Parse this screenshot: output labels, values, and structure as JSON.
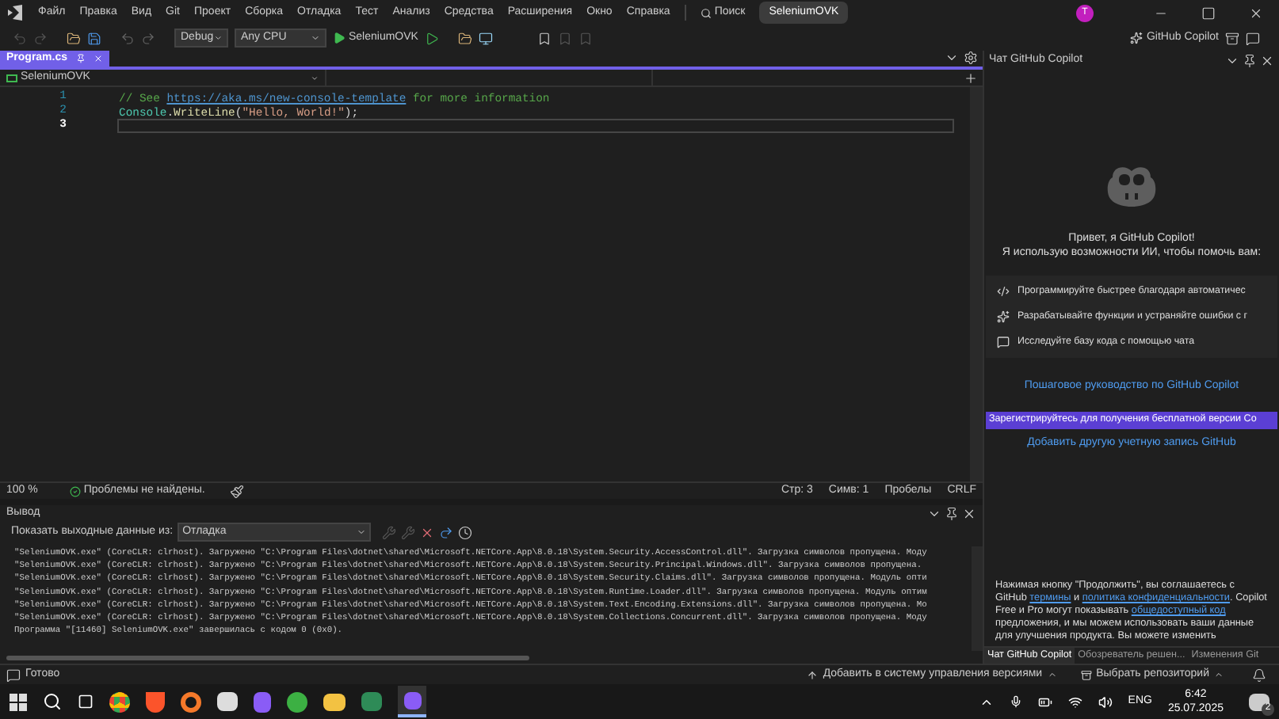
{
  "menu_bar": {
    "items": [
      "Файл",
      "Правка",
      "Вид",
      "Git",
      "Проект",
      "Сборка",
      "Отладка",
      "Тест",
      "Анализ",
      "Средства",
      "Расширения",
      "Окно",
      "Справка"
    ],
    "search": "Поиск",
    "solution": "SeleniumOVK",
    "avatar": "T"
  },
  "toolbar": {
    "configuration": "Debug",
    "platform": "Any CPU",
    "run_target": "SeleniumOVK",
    "copilot": "GitHub Copilot"
  },
  "editor": {
    "tabs": [
      {
        "label": "Program.cs",
        "selected": true
      }
    ],
    "nav": {
      "project": "SeleniumOVK"
    },
    "lines": [
      {
        "number": "1",
        "current": false,
        "tokens": [
          {
            "kind": "comment",
            "text": "// See "
          },
          {
            "kind": "link",
            "text": "https://aka.ms/new-console-template"
          },
          {
            "kind": "comment",
            "text": " for more information"
          }
        ]
      },
      {
        "number": "2",
        "current": false,
        "tokens": [
          {
            "kind": "type",
            "text": "Console"
          },
          {
            "kind": "plain",
            "text": "."
          },
          {
            "kind": "method",
            "text": "WriteLine"
          },
          {
            "kind": "plain",
            "text": "("
          },
          {
            "kind": "string",
            "text": "\"Hello, World!\""
          },
          {
            "kind": "plain",
            "text": ");"
          }
        ]
      },
      {
        "number": "3",
        "current": true
      }
    ]
  },
  "editor_status": {
    "zoom": "100 %",
    "issues": "Проблемы не найдены.",
    "line": "Стр: 3",
    "column": "Симв: 1",
    "whitespace": "Пробелы",
    "line_ending": "CRLF"
  },
  "output": {
    "title": "Вывод",
    "source_label": "Показать выходные данные из:",
    "source": "Отладка",
    "lines": [
      "\"SeleniumOVK.exe\" (CoreCLR: clrhost). Загружено \"C:\\Program Files\\dotnet\\shared\\Microsoft.NETCore.App\\8.0.18\\System.Security.AccessControl.dll\". Загрузка символов пропущена. Моду",
      "\"SeleniumOVK.exe\" (CoreCLR: clrhost). Загружено \"C:\\Program Files\\dotnet\\shared\\Microsoft.NETCore.App\\8.0.18\\System.Security.Principal.Windows.dll\". Загрузка символов пропущена.",
      "\"SeleniumOVK.exe\" (CoreCLR: clrhost). Загружено \"C:\\Program Files\\dotnet\\shared\\Microsoft.NETCore.App\\8.0.18\\System.Security.Claims.dll\". Загрузка символов пропущена. Модуль опти",
      "\"SeleniumOVK.exe\" (CoreCLR: clrhost). Загружено \"C:\\Program Files\\dotnet\\shared\\Microsoft.NETCore.App\\8.0.18\\System.Runtime.Loader.dll\". Загрузка символов пропущена. Модуль оптим",
      "\"SeleniumOVK.exe\" (CoreCLR: clrhost). Загружено \"C:\\Program Files\\dotnet\\shared\\Microsoft.NETCore.App\\8.0.18\\System.Text.Encoding.Extensions.dll\". Загрузка символов пропущена. Мо",
      "\"SeleniumOVK.exe\" (CoreCLR: clrhost). Загружено \"C:\\Program Files\\dotnet\\shared\\Microsoft.NETCore.App\\8.0.18\\System.Collections.Concurrent.dll\". Загрузка символов пропущена. Моду",
      "Программа \"[11460] SeleniumOVK.exe\" завершилась с кодом 0 (0x0)."
    ]
  },
  "copilot": {
    "title": "Чат GitHub Copilot",
    "greeting": [
      "Привет, я GitHub Copilot!",
      "Я использую возможности ИИ, чтобы помочь вам:"
    ],
    "features": [
      {
        "kind": "complete",
        "text": "Программируйте быстрее благодаря автоматичес"
      },
      {
        "kind": "fix",
        "text": "Разрабатывайте функции и устраняйте ошибки с г"
      },
      {
        "kind": "chat",
        "text": "Исследуйте базу кода с помощью чата"
      }
    ],
    "guide_link": "Пошаговое руководство по GitHub Copilot",
    "signup_button": "Зарегистрируйтесь для получения бесплатной версии Co",
    "add_account_link": "Добавить другую учетную запись GitHub",
    "disclaimer": [
      {
        "kind": "text",
        "text": "Нажимая кнопку \"Продолжить\", вы соглашаетесь с GitHub "
      },
      {
        "kind": "link",
        "text": "термины"
      },
      {
        "kind": "text",
        "text": " и "
      },
      {
        "kind": "link",
        "text": "политика конфиденциальности"
      },
      {
        "kind": "text",
        "text": ". Copilot Free и Pro могут показывать "
      },
      {
        "kind": "link",
        "text": "общедоступный код"
      },
      {
        "kind": "text",
        "text": " предложения, и мы можем использовать ваши данные для улучшения продукта. Вы можете изменить"
      }
    ],
    "tabs": [
      {
        "label": "Чат GitHub Copilot",
        "selected": true
      },
      {
        "label": "Обозреватель решен...",
        "selected": false
      },
      {
        "label": "Изменения Git",
        "selected": false
      }
    ]
  },
  "status_bar": {
    "state": "Готово",
    "add_to_vcs": "Добавить в систему управления версиями",
    "repository": "Выбрать репозиторий"
  },
  "taskbar": {
    "language": "ENG",
    "time": "6:42",
    "date": "25.07.2025",
    "notifications": "2"
  }
}
